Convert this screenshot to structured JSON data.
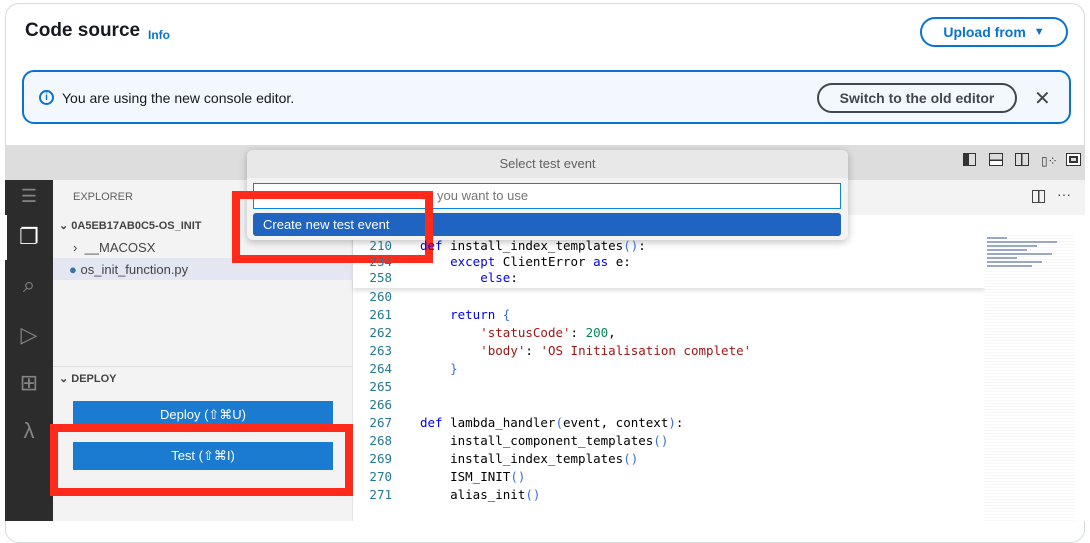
{
  "header": {
    "title": "Code source",
    "info_link": "Info",
    "upload_button": "Upload from"
  },
  "banner": {
    "message": "You are using the new console editor.",
    "switch_button": "Switch to the old editor"
  },
  "sidebar": {
    "explorer_label": "EXPLORER",
    "folder": "0A5EB17AB0C5-OS_INIT",
    "items": [
      {
        "label": "__MACOSX",
        "type": "folder"
      },
      {
        "label": "os_init_function.py",
        "type": "python-file",
        "selected": true
      }
    ],
    "deploy_section": "DEPLOY",
    "deploy_button": "Deploy (⇧⌘U)",
    "test_button": "Test (⇧⌘I)"
  },
  "quick_pick": {
    "title": "Select test event",
    "placeholder": "you want to use",
    "item": "Create new test event"
  },
  "editor": {
    "sticky": [
      {
        "ln": "210",
        "code": "def install_index_templates():"
      },
      {
        "ln": "234",
        "code": "    except ClientError as e:"
      },
      {
        "ln": "258",
        "code": "        else:"
      }
    ],
    "lines": [
      {
        "ln": "260",
        "code": ""
      },
      {
        "ln": "261",
        "code": "    return {"
      },
      {
        "ln": "262",
        "code": "        'statusCode': 200,"
      },
      {
        "ln": "263",
        "code": "        'body': 'OS Initialisation complete'"
      },
      {
        "ln": "264",
        "code": "    }"
      },
      {
        "ln": "265",
        "code": ""
      },
      {
        "ln": "266",
        "code": ""
      },
      {
        "ln": "267",
        "code": "def lambda_handler(event, context):"
      },
      {
        "ln": "268",
        "code": "    install_component_templates()"
      },
      {
        "ln": "269",
        "code": "    install_index_templates()"
      },
      {
        "ln": "270",
        "code": "    ISM_INIT()"
      },
      {
        "ln": "271",
        "code": "    alias_init()"
      }
    ]
  },
  "colors": {
    "accent": "#0972d3",
    "highlight_box": "#ff2a1a",
    "button": "#1a7bd0"
  }
}
